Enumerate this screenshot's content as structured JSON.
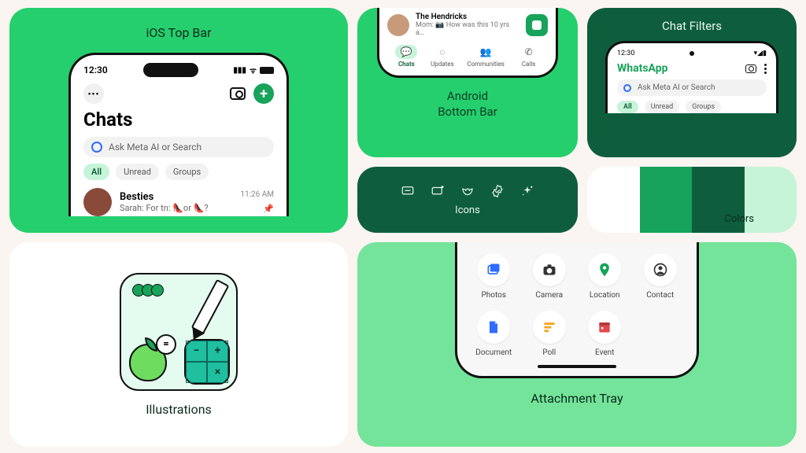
{
  "ios": {
    "card_title": "iOS Top Bar",
    "time": "12:30",
    "screen_title": "Chats",
    "search_placeholder": "Ask Meta AI or Search",
    "filters": [
      "All",
      "Unread",
      "Groups"
    ],
    "chat": {
      "name": "Besties",
      "preview": "Sarah: For tn: 👠or 👠?",
      "time": "11:26 AM"
    }
  },
  "android": {
    "card_title_line1": "Android",
    "card_title_line2": "Bottom Bar",
    "chat": {
      "name": "The Hendricks",
      "preview": "Mom: 📷 How was this 10 yrs a…"
    },
    "tabs": [
      {
        "label": "Chats",
        "active": true
      },
      {
        "label": "Updates",
        "active": false
      },
      {
        "label": "Communities",
        "active": false
      },
      {
        "label": "Calls",
        "active": false
      }
    ]
  },
  "filters": {
    "card_title": "Chat Filters",
    "time": "12:30",
    "app_name": "WhatsApp",
    "search_placeholder": "Ask Meta AI or Search",
    "pills": [
      "All",
      "Unread",
      "Groups"
    ]
  },
  "icons": {
    "card_title": "Icons"
  },
  "colors": {
    "card_title": "Colors",
    "swatches": [
      "#ffffff",
      "#17a35a",
      "#0e5e3e",
      "#c6f4d9"
    ]
  },
  "illustrations": {
    "card_title": "Illustrations"
  },
  "tray": {
    "card_title": "Attachment Tray",
    "items": [
      {
        "label": "Photos",
        "color": "#2f6cff"
      },
      {
        "label": "Camera",
        "color": "#333333"
      },
      {
        "label": "Location",
        "color": "#17a35a"
      },
      {
        "label": "Contact",
        "color": "#333333"
      },
      {
        "label": "Document",
        "color": "#2f6cff"
      },
      {
        "label": "Poll",
        "color": "#f5a623"
      },
      {
        "label": "Event",
        "color": "#e14b4b"
      }
    ]
  }
}
